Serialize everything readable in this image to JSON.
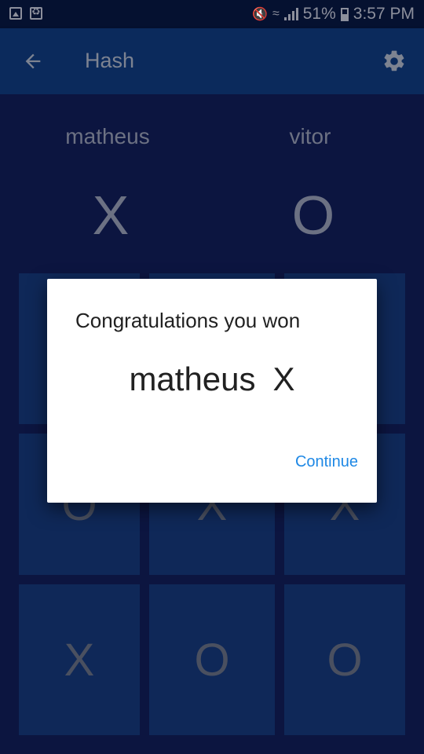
{
  "status_bar": {
    "left_icons": [
      "image-icon",
      "recycle-icon"
    ],
    "battery_percent": "51%",
    "time": "3:57 PM"
  },
  "app_bar": {
    "title": "Hash",
    "back_icon": "arrow-back-icon",
    "settings_icon": "gear-icon"
  },
  "players": [
    {
      "name": "matheus",
      "symbol": "X"
    },
    {
      "name": "vitor",
      "symbol": "O"
    }
  ],
  "board": {
    "cells": [
      [
        "",
        "",
        ""
      ],
      [
        "O",
        "X",
        "X"
      ],
      [
        "X",
        "O",
        "O"
      ]
    ]
  },
  "dialog": {
    "title": "Congratulations you won",
    "winner_name": "matheus",
    "winner_symbol": "X",
    "continue_label": "Continue"
  },
  "colors": {
    "accent": "#1e88e5",
    "app_bar": "#0b2a5c",
    "background": "#0c1540",
    "cell": "#0f2858"
  }
}
